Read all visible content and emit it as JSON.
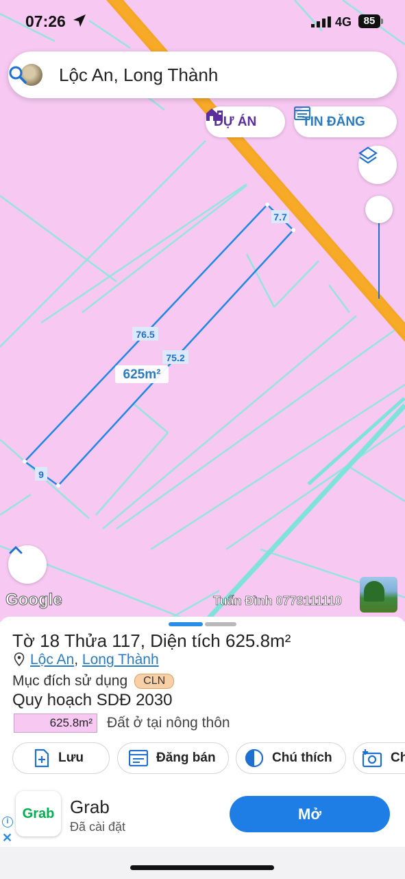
{
  "status": {
    "time": "07:26",
    "network": "4G",
    "battery": "85"
  },
  "search": {
    "query": "Lộc An, Long Thành"
  },
  "chips": {
    "duan": "DỰ ÁN",
    "tindang": "TIN ĐĂNG"
  },
  "map": {
    "edge_labels": {
      "top": "7.7",
      "left": "76.5",
      "right": "75.2",
      "bottom": "9"
    },
    "area_label": "625m²",
    "google": "Google",
    "watermark": "Tuấn Đình 0778111110"
  },
  "sheet": {
    "title": "Tờ 18 Thửa 117, Diện tích 625.8m²",
    "address": {
      "commune": "Lộc An",
      "district": "Long Thành"
    },
    "purpose_label": "Mục đích sử dụng",
    "purpose_code": "CLN",
    "plan_title": "Quy hoạch SDĐ 2030",
    "plan_area": "625.8m²",
    "plan_type": "Đất ở tại nông thôn",
    "actions": {
      "save": "Lưu",
      "sell": "Đăng bán",
      "legend": "Chú thích",
      "capture": "Ch"
    }
  },
  "ad": {
    "app": "Grab",
    "logo": "Grab",
    "status": "Đã cài đặt",
    "open": "Mở"
  },
  "colors": {
    "map_fill": "#f6c8f2",
    "parcel_line": "#1e88e5",
    "road": "#f5a623",
    "boundary": "#7fe3dc",
    "accent": "#1e7ee6"
  }
}
